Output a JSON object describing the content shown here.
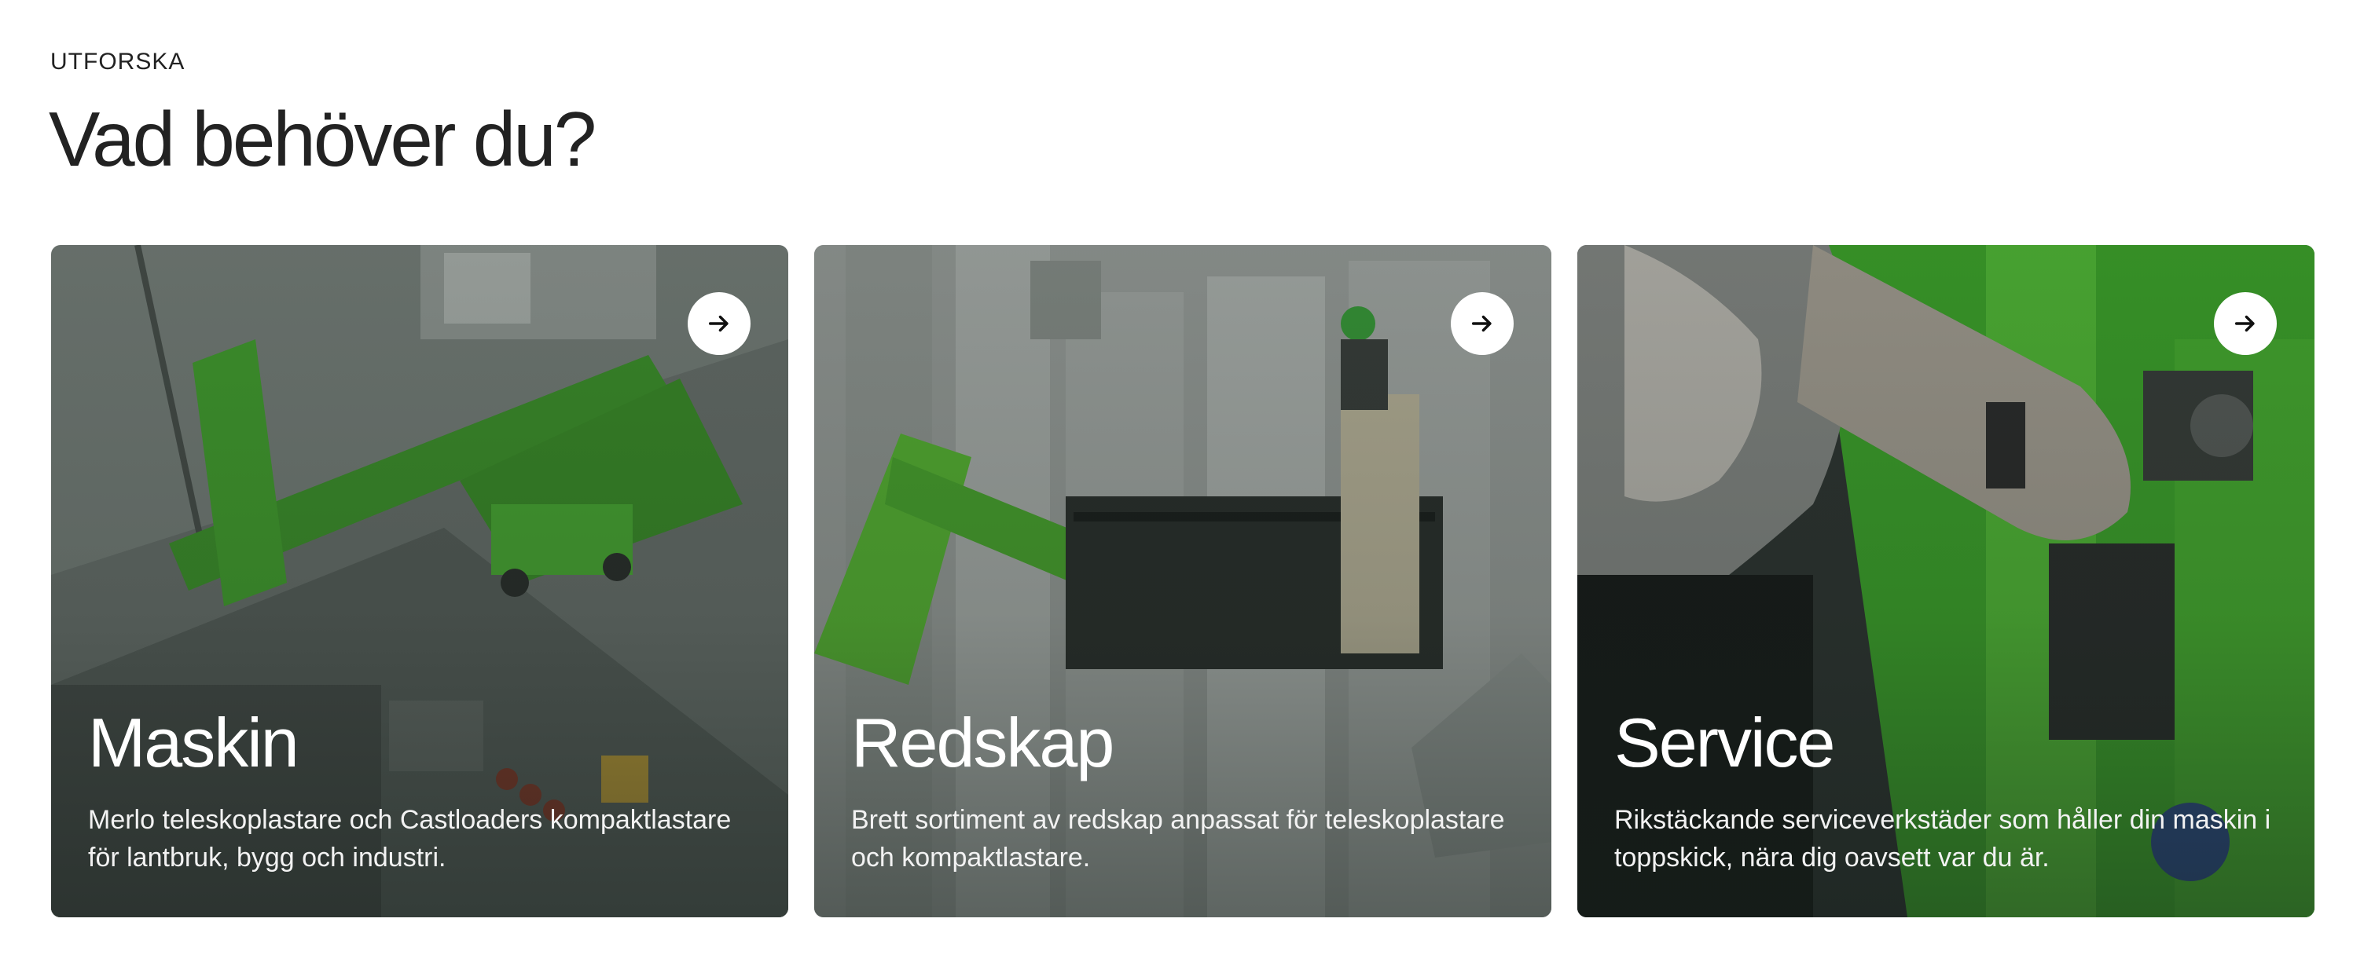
{
  "section": {
    "eyebrow": "UTFORSKA",
    "heading": "Vad behöver du?"
  },
  "cards": [
    {
      "title": "Maskin",
      "description": "Merlo teleskoplastare och Castloaders kompaktlastare för lantbruk, bygg och industri.",
      "icon": "arrow-right-icon"
    },
    {
      "title": "Redskap",
      "description": "Brett sortiment av redskap anpassat för teleskoplastare och kompaktlastare.",
      "icon": "arrow-right-icon"
    },
    {
      "title": "Service",
      "description": "Rikstäckande serviceverkstäder som håller din maskin i toppskick, nära dig oavsett var du är.",
      "icon": "arrow-right-icon"
    }
  ],
  "colors": {
    "brand_green": "#5fc83a",
    "overlay": "#1e2a24",
    "text_dark": "#222222",
    "button_bg": "#ffffff"
  }
}
